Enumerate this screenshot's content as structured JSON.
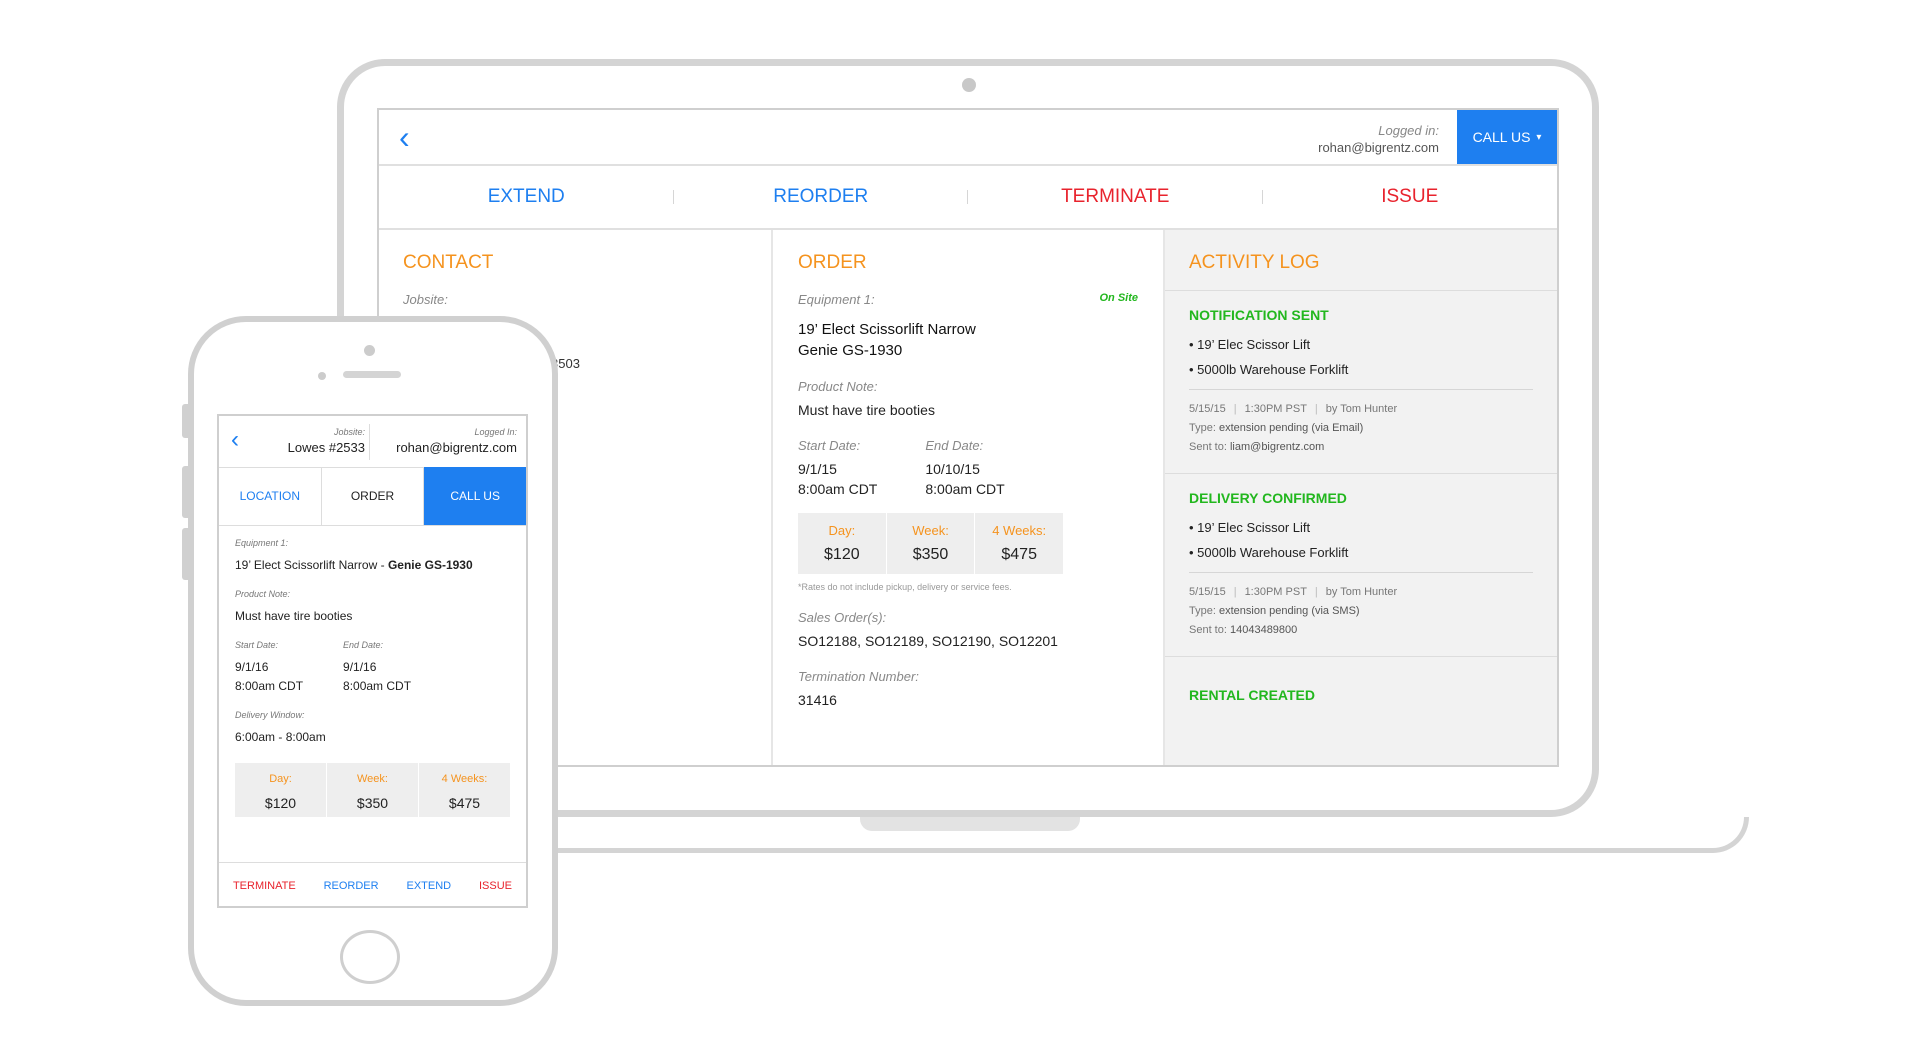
{
  "laptop": {
    "header": {
      "back_icon": "‹",
      "logged_in_label": "Logged in:",
      "logged_in_user": "rohan@bigrentz.com",
      "call_us": "CALL US",
      "call_us_caret": "▾"
    },
    "actions": [
      "EXTEND",
      "REORDER",
      "TERMINATE",
      "ISSUE"
    ],
    "contact": {
      "title": "CONTACT",
      "jobsite_label": "Jobsite:",
      "partial_text": "3503"
    },
    "order": {
      "title": "ORDER",
      "equipment_label": "Equipment 1:",
      "status": "On Site",
      "equipment_name": "19’ Elect Scissorlift Narrow",
      "equipment_model": "Genie GS-1930",
      "product_note_label": "Product Note:",
      "product_note": "Must have tire booties",
      "start_date_label": "Start Date:",
      "start_date": "9/1/15",
      "start_time": "8:00am CDT",
      "end_date_label": "End Date:",
      "end_date": "10/10/15",
      "end_time": "8:00am CDT",
      "rates": [
        {
          "label": "Day:",
          "value": "$120"
        },
        {
          "label": "Week:",
          "value": "$350"
        },
        {
          "label": "4 Weeks:",
          "value": "$475"
        }
      ],
      "rates_note": "*Rates do not include pickup, delivery or service fees.",
      "sales_orders_label": "Sales Order(s):",
      "sales_orders": "SO12188, SO12189, SO12190, SO12201",
      "termination_label": "Termination Number:",
      "termination_number": "31416"
    },
    "activity": {
      "title": "ACTIVITY LOG",
      "entries": [
        {
          "heading": "NOTIFICATION SENT",
          "items": [
            "• 19’ Elec Scissor Lift",
            "• 5000lb Warehouse Forklift"
          ],
          "date": "5/15/15",
          "time": "1:30PM PST",
          "by": "by Tom Hunter",
          "type_label": "Type:",
          "type": "extension pending (via Email)",
          "sent_label": "Sent to:",
          "sent_to": "liam@bigrentz.com"
        },
        {
          "heading": "DELIVERY CONFIRMED",
          "items": [
            "• 19’ Elec Scissor Lift",
            "• 5000lb Warehouse Forklift"
          ],
          "date": "5/15/15",
          "time": "1:30PM PST",
          "by": "by Tom Hunter",
          "type_label": "Type:",
          "type": "extension pending (via SMS)",
          "sent_label": "Sent to:",
          "sent_to": "14043489800"
        },
        {
          "heading": "RENTAL CREATED"
        }
      ]
    }
  },
  "phone": {
    "back_icon": "‹",
    "jobsite_label": "Jobsite:",
    "jobsite": "Lowes #2533",
    "logged_in_label": "Logged In:",
    "logged_in_user": "rohan@bigrentz.com",
    "tabs": [
      "LOCATION",
      "ORDER",
      "CALL US"
    ],
    "equipment_label": "Equipment 1:",
    "equipment_name": "19’ Elect Scissorlift Narrow - ",
    "equipment_model": "Genie GS-1930",
    "product_note_label": "Product Note:",
    "product_note": "Must have tire booties",
    "start_date_label": "Start Date:",
    "start_date": "9/1/16",
    "start_time": "8:00am CDT",
    "end_date_label": "End Date:",
    "end_date": "9/1/16",
    "end_time": "8:00am CDT",
    "delivery_label": "Delivery Window:",
    "delivery_window": "6:00am - 8:00am",
    "rates": [
      {
        "label": "Day:",
        "value": "$120"
      },
      {
        "label": "Week:",
        "value": "$350"
      },
      {
        "label": "4 Weeks:",
        "value": "$475"
      }
    ],
    "footer": [
      "TERMINATE",
      "REORDER",
      "EXTEND",
      "ISSUE"
    ]
  },
  "colors": {
    "accent_blue": "#1e7ff0",
    "danger_red": "#e8232d",
    "section_orange": "#f5931e",
    "success_green": "#22b71e"
  }
}
